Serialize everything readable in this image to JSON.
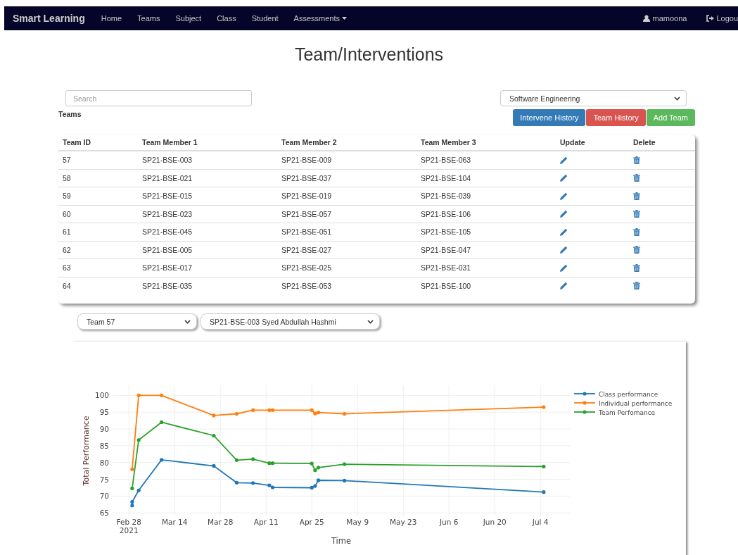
{
  "navbar": {
    "brand": "Smart Learning",
    "items": [
      {
        "label": "Home",
        "kind": "link"
      },
      {
        "label": "Teams",
        "kind": "link"
      },
      {
        "label": "Subject",
        "kind": "link"
      },
      {
        "label": "Class",
        "kind": "link"
      },
      {
        "label": "Student",
        "kind": "link"
      },
      {
        "label": "Assessments",
        "kind": "dropdown"
      }
    ],
    "user": "mamoona",
    "logout": "Logou"
  },
  "title": "Team/Interventions",
  "search": {
    "placeholder": "Search"
  },
  "subject_select": {
    "value": "Software Engineering"
  },
  "section_label": "Teams",
  "buttons": [
    {
      "label": "Intervene History",
      "color": "#337ab7"
    },
    {
      "label": "Team History",
      "color": "#d9534f"
    },
    {
      "label": "Add Team",
      "color": "#5cb85c"
    }
  ],
  "table": {
    "columns": [
      "Team ID",
      "Team Member 1",
      "Team Member 2",
      "Team Member 3",
      "Update",
      "Delete"
    ],
    "rows": [
      {
        "id": "57",
        "m1": "SP21-BSE-003",
        "m2": "SP21-BSE-009",
        "m3": "SP21-BSE-063"
      },
      {
        "id": "58",
        "m1": "SP21-BSE-021",
        "m2": "SP21-BSE-037",
        "m3": "SP21-BSE-104"
      },
      {
        "id": "59",
        "m1": "SP21-BSE-015",
        "m2": "SP21-BSE-019",
        "m3": "SP21-BSE-039"
      },
      {
        "id": "60",
        "m1": "SP21-BSE-023",
        "m2": "SP21-BSE-057",
        "m3": "SP21-BSE-106"
      },
      {
        "id": "61",
        "m1": "SP21-BSE-045",
        "m2": "SP21-BSE-051",
        "m3": "SP21-BSE-105"
      },
      {
        "id": "62",
        "m1": "SP21-BSE-005",
        "m2": "SP21-BSE-027",
        "m3": "SP21-BSE-047"
      },
      {
        "id": "63",
        "m1": "SP21-BSE-017",
        "m2": "SP21-BSE-025",
        "m3": "SP21-BSE-031"
      },
      {
        "id": "64",
        "m1": "SP21-BSE-035",
        "m2": "SP21-BSE-053",
        "m3": "SP21-BSE-100"
      }
    ]
  },
  "team_select": {
    "value": "Team 57"
  },
  "student_select": {
    "value": "SP21-BSE-003 Syed Abdullah Hashmi"
  },
  "chart_data": {
    "type": "line",
    "grid": true,
    "legend": "right",
    "xlabel": "Time",
    "ylabel": "Total Performance",
    "x": [
      "2021-03-01",
      "2021-03-01",
      "2021-03-03",
      "2021-03-10",
      "2021-03-26",
      "2021-04-02",
      "2021-04-07",
      "2021-04-12",
      "2021-04-13",
      "2021-04-25",
      "2021-04-26",
      "2021-04-27",
      "2021-05-05",
      "2021-07-05"
    ],
    "series": [
      {
        "name": "Class performance",
        "color": "#1f77b4",
        "values": [
          67.2,
          68.3,
          71.7,
          80.8,
          79,
          74,
          73.9,
          73.2,
          72.6,
          72.5,
          73,
          74.7,
          74.6,
          71.2
        ]
      },
      {
        "name": "Individual performance",
        "color": "#ff7f0e",
        "values": [
          null,
          78,
          100,
          100,
          94,
          94.5,
          95.6,
          95.6,
          95.6,
          95.6,
          94.6,
          94.9,
          94.5,
          96.5
        ]
      },
      {
        "name": "Team Perfomance",
        "color": "#2ca02c",
        "values": [
          null,
          72.3,
          86.7,
          92,
          88,
          80.7,
          81,
          79.8,
          79.8,
          79.7,
          77.7,
          78.5,
          79.5,
          78.8
        ]
      }
    ],
    "xlim": [
      "2021-02-23",
      "2021-07-13"
    ],
    "ylim": [
      64,
      103
    ],
    "xticks": [
      {
        "value": "2021-02-28",
        "label": "Feb 28\n2021"
      },
      {
        "value": "2021-03-14",
        "label": "Mar 14"
      },
      {
        "value": "2021-03-28",
        "label": "Mar 28"
      },
      {
        "value": "2021-04-11",
        "label": "Apr 11"
      },
      {
        "value": "2021-04-25",
        "label": "Apr 25"
      },
      {
        "value": "2021-05-09",
        "label": "May 9"
      },
      {
        "value": "2021-05-23",
        "label": "May 23"
      },
      {
        "value": "2021-06-06",
        "label": "Jun 6"
      },
      {
        "value": "2021-06-20",
        "label": "Jun 20"
      },
      {
        "value": "2021-07-04",
        "label": "Jul 4"
      }
    ],
    "yticks": [
      65,
      70,
      75,
      80,
      85,
      90,
      95,
      100
    ]
  }
}
